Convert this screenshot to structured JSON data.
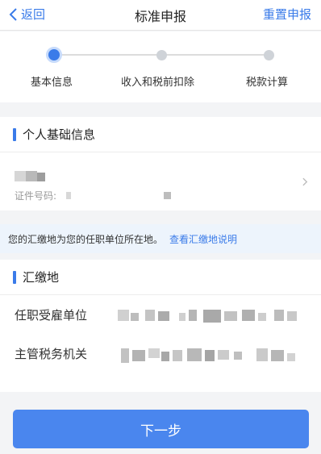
{
  "nav": {
    "back_label": "返回",
    "title": "标准申报",
    "reset_label": "重置申报"
  },
  "steps": [
    {
      "label": "基本信息",
      "active": true
    },
    {
      "label": "收入和税前扣除",
      "active": false
    },
    {
      "label": "税款计算",
      "active": false
    }
  ],
  "personal": {
    "section_title": "个人基础信息",
    "id_label": "证件号码:"
  },
  "notice": {
    "text": "您的汇缴地为您的任职单位所在地。",
    "link": "查看汇缴地说明"
  },
  "location": {
    "section_title": "汇缴地",
    "employer_label": "任职受雇单位",
    "tax_authority_label": "主管税务机关"
  },
  "next_button": "下一步",
  "colors": {
    "accent": "#3a7be9",
    "button": "#4a86ee",
    "notice_bg": "#edf4fc"
  }
}
